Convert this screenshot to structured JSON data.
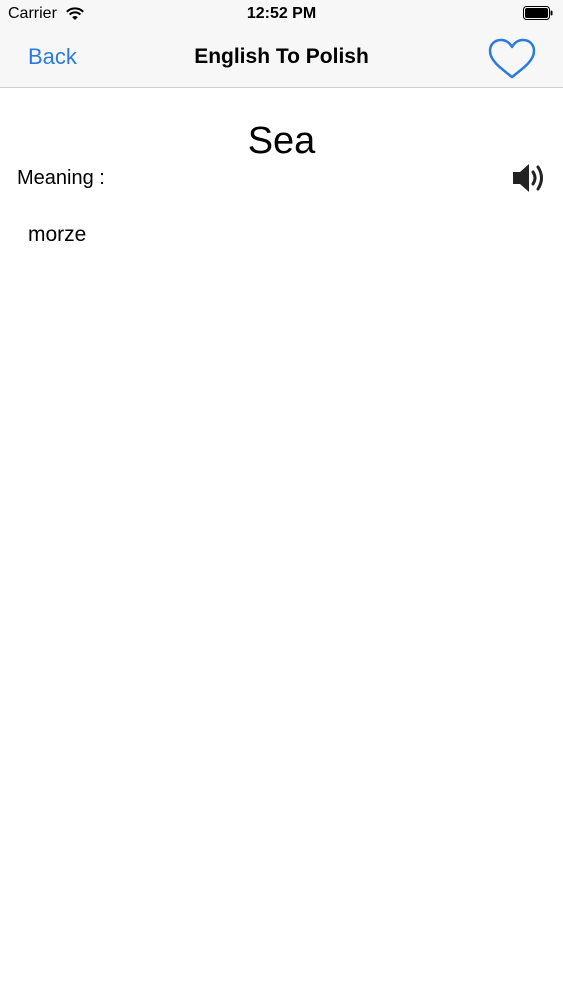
{
  "status_bar": {
    "carrier": "Carrier",
    "time": "12:52 PM",
    "wifi_icon": "wifi-icon",
    "battery_icon": "battery-icon"
  },
  "nav": {
    "back_label": "Back",
    "title": "English To Polish",
    "favorite_icon": "heart-outline-icon"
  },
  "entry": {
    "word": "Sea",
    "meaning_label": "Meaning :",
    "translation": "morze",
    "speaker_icon": "speaker-icon"
  },
  "colors": {
    "accent": "#2a7bde",
    "nav_background": "#f7f7f7",
    "divider": "#cfcfcf"
  }
}
